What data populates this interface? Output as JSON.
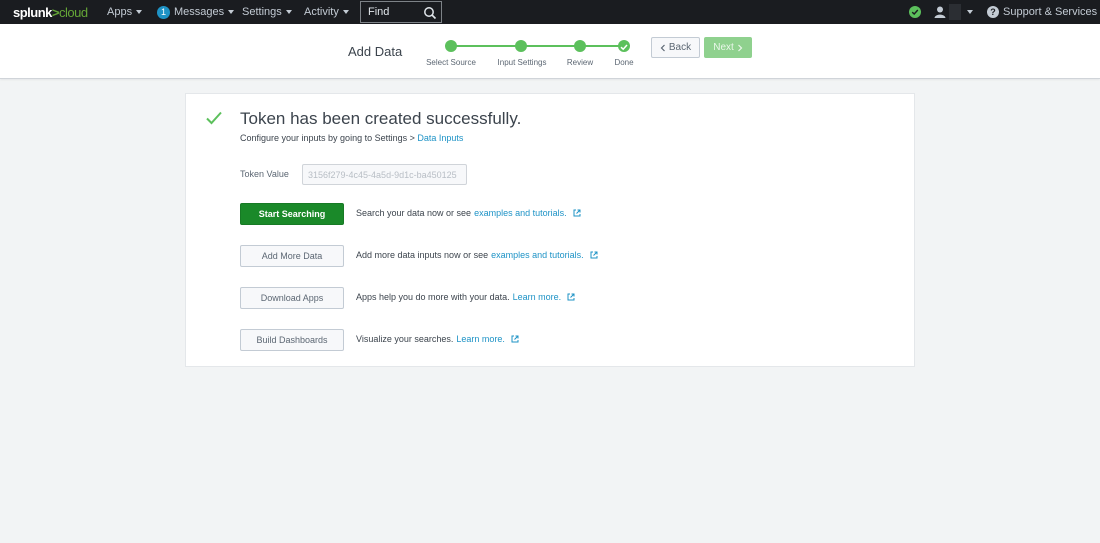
{
  "topnav": {
    "logo_main": "splunk",
    "logo_sep": ">",
    "logo_suffix": "cloud",
    "apps": "Apps",
    "messages_count": "1",
    "messages": "Messages",
    "settings": "Settings",
    "activity": "Activity",
    "find_placeholder": "Find",
    "support": "Support & Services"
  },
  "wizard": {
    "title": "Add Data",
    "steps": [
      "Select Source",
      "Input Settings",
      "Review",
      "Done"
    ],
    "back": "Back",
    "next": "Next"
  },
  "result": {
    "title": "Token has been created successfully.",
    "subtitle_prefix": "Configure your inputs by going to Settings > ",
    "subtitle_link": "Data Inputs",
    "token_label": "Token Value",
    "token_value": "3156f279-4c45-4a5d-9d1c-ba450125",
    "actions": [
      {
        "button": "Start Searching",
        "text": "Search your data now or see ",
        "link": "examples and tutorials."
      },
      {
        "button": "Add More Data",
        "text": "Add more data inputs now or see ",
        "link": "examples and tutorials."
      },
      {
        "button": "Download Apps",
        "text": "Apps help you do more with your data. ",
        "link": "Learn more."
      },
      {
        "button": "Build Dashboards",
        "text": "Visualize your searches. ",
        "link": "Learn more."
      }
    ]
  },
  "colors": {
    "accent_green": "#5cc05c",
    "primary_button": "#1a8929",
    "link": "#1e93c6",
    "nav_bg": "#1a1c20"
  }
}
